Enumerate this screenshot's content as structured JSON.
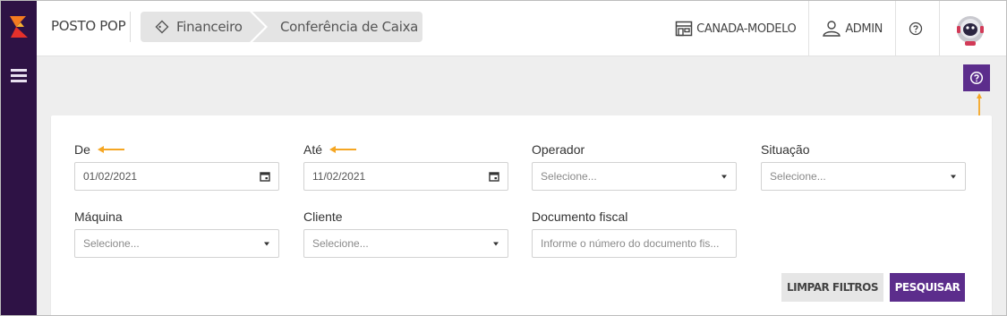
{
  "header": {
    "brand": "POSTO POP",
    "breadcrumb": [
      "Financeiro",
      "Conferência de Caixa"
    ],
    "company": "CANADA-MODELO",
    "user": "ADMIN"
  },
  "icons": {
    "logo": "brand-logo-icon",
    "menu": "menu-icon",
    "breadcrumb_first": "tag-icon",
    "company": "store-icon",
    "user": "user-icon",
    "help": "help-circle-icon",
    "avatar": "astronaut-avatar",
    "calendar": "calendar-icon",
    "dropdown": "caret-down-icon",
    "annotation_arrow": "orange-arrow-icon"
  },
  "filters": {
    "de": {
      "label": "De",
      "value": "01/02/2021"
    },
    "ate": {
      "label": "Até",
      "value": "11/02/2021"
    },
    "operador": {
      "label": "Operador",
      "placeholder": "Selecione..."
    },
    "situacao": {
      "label": "Situação",
      "placeholder": "Selecione..."
    },
    "maquina": {
      "label": "Máquina",
      "placeholder": "Selecione..."
    },
    "cliente": {
      "label": "Cliente",
      "placeholder": "Selecione..."
    },
    "documento": {
      "label": "Documento fiscal",
      "placeholder": "Informe o número do documento fis..."
    }
  },
  "actions": {
    "clear": "LIMPAR FILTROS",
    "search": "PESQUISAR"
  },
  "colors": {
    "sidebar": "#2e1245",
    "primary": "#5c2d8c",
    "annotation": "#f5a623",
    "logo_top": "#f47b20",
    "logo_bottom": "#e4312b"
  }
}
